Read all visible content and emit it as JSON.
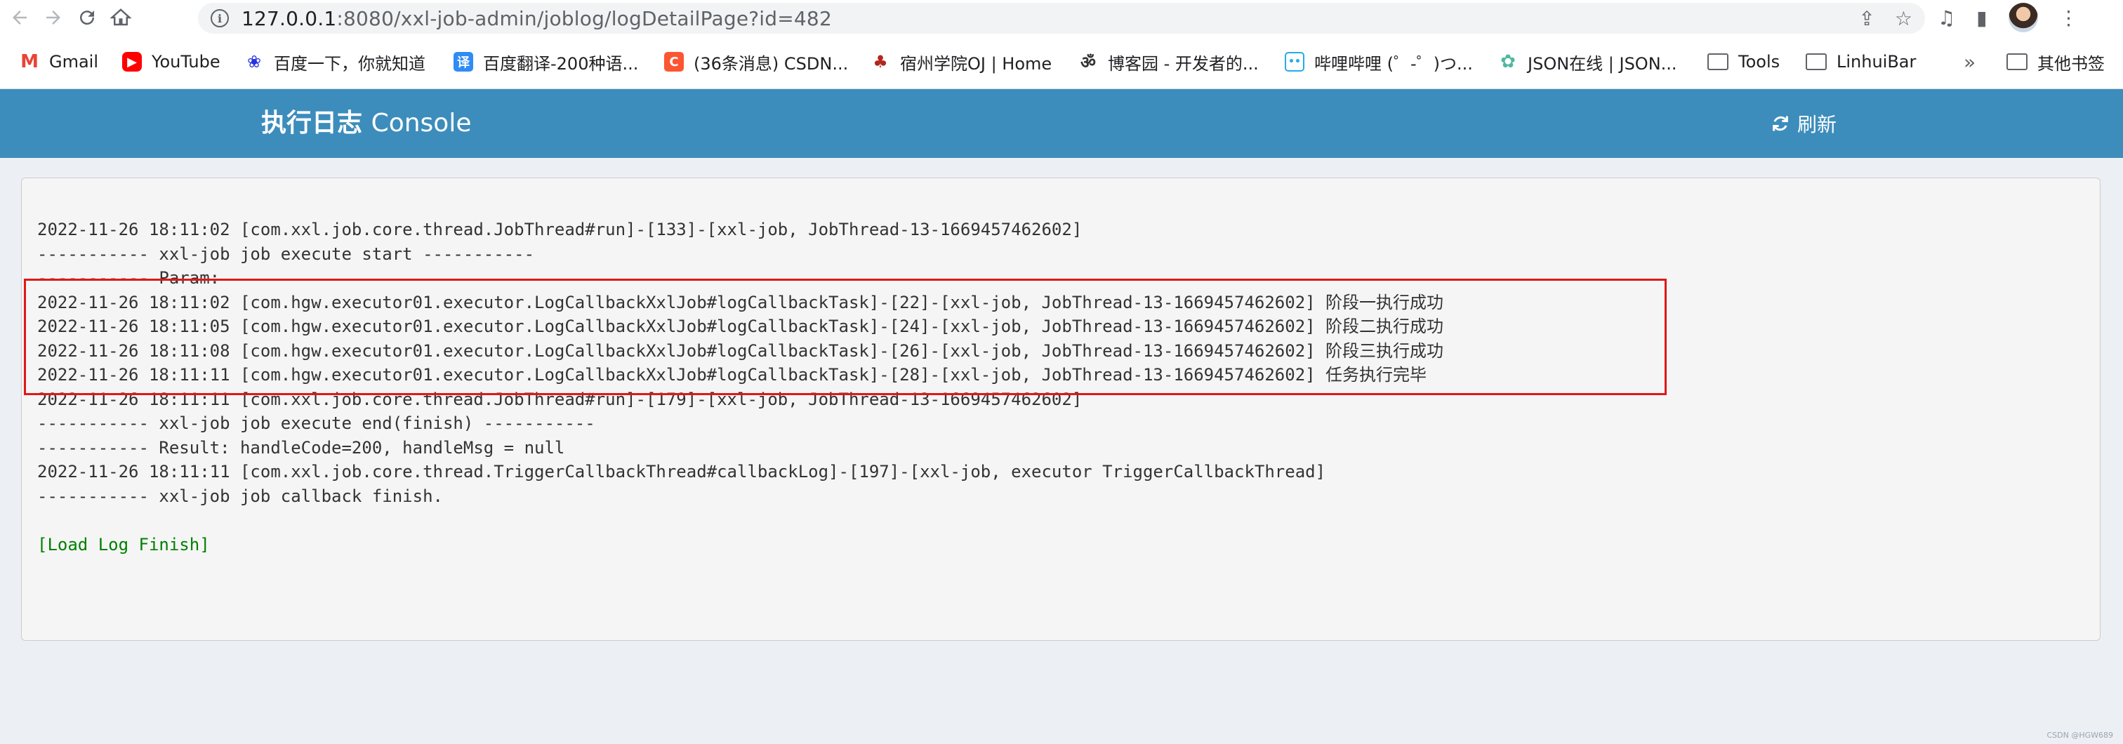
{
  "browser": {
    "url_host": "127.0.0.1",
    "url_rest": ":8080/xxl-job-admin/joblog/logDetailPage?id=482",
    "bookmarks": [
      {
        "label": "Gmail",
        "icon": "gmail-icon"
      },
      {
        "label": "YouTube",
        "icon": "youtube-icon"
      },
      {
        "label": "百度一下，你就知道",
        "icon": "baidu-icon"
      },
      {
        "label": "百度翻译-200种语...",
        "icon": "fanyi-icon"
      },
      {
        "label": "(36条消息) CSDN...",
        "icon": "csdn-icon"
      },
      {
        "label": "宿州学院OJ | Home",
        "icon": "oj-icon"
      },
      {
        "label": "博客园 - 开发者的...",
        "icon": "cnblogs-icon"
      },
      {
        "label": "哔哩哔哩 (゜-゜)つ...",
        "icon": "bilibili-icon"
      },
      {
        "label": "JSON在线 | JSON...",
        "icon": "json-icon"
      },
      {
        "label": "Tools",
        "icon": "folder-icon"
      },
      {
        "label": "LinhuiBar",
        "icon": "folder-icon"
      }
    ],
    "other_bookmarks": "其他书签",
    "colors": {
      "gmail": "#ea4335",
      "youtube": "#ff0000",
      "baidu": "#2932e1",
      "fanyi": "#2f8cf5",
      "csdn": "#fc5531",
      "bilibili": "#23ade5",
      "json": "#4fb8a0"
    }
  },
  "header": {
    "title_cn": "执行日志",
    "title_en": "Console",
    "refresh_label": "刷新",
    "color": "#3c8dbc"
  },
  "log": {
    "lines": [
      "2022-11-26 18:11:02 [com.xxl.job.core.thread.JobThread#run]-[133]-[xxl-job, JobThread-13-1669457462602]",
      "----------- xxl-job job execute start -----------",
      "----------- Param:",
      "2022-11-26 18:11:02 [com.hgw.executor01.executor.LogCallbackXxlJob#logCallbackTask]-[22]-[xxl-job, JobThread-13-1669457462602] 阶段一执行成功",
      "2022-11-26 18:11:05 [com.hgw.executor01.executor.LogCallbackXxlJob#logCallbackTask]-[24]-[xxl-job, JobThread-13-1669457462602] 阶段二执行成功",
      "2022-11-26 18:11:08 [com.hgw.executor01.executor.LogCallbackXxlJob#logCallbackTask]-[26]-[xxl-job, JobThread-13-1669457462602] 阶段三执行成功",
      "2022-11-26 18:11:11 [com.hgw.executor01.executor.LogCallbackXxlJob#logCallbackTask]-[28]-[xxl-job, JobThread-13-1669457462602] 任务执行完毕",
      "2022-11-26 18:11:11 [com.xxl.job.core.thread.JobThread#run]-[179]-[xxl-job, JobThread-13-1669457462602]",
      "----------- xxl-job job execute end(finish) -----------",
      "----------- Result: handleCode=200, handleMsg = null",
      "2022-11-26 18:11:11 [com.xxl.job.core.thread.TriggerCallbackThread#callbackLog]-[197]-[xxl-job, executor TriggerCallbackThread]",
      "----------- xxl-job job callback finish."
    ],
    "finish_label": "[Load Log Finish]",
    "finish_color": "#008000",
    "highlight_color": "#e01818"
  },
  "watermark": "CSDN @HGW689"
}
